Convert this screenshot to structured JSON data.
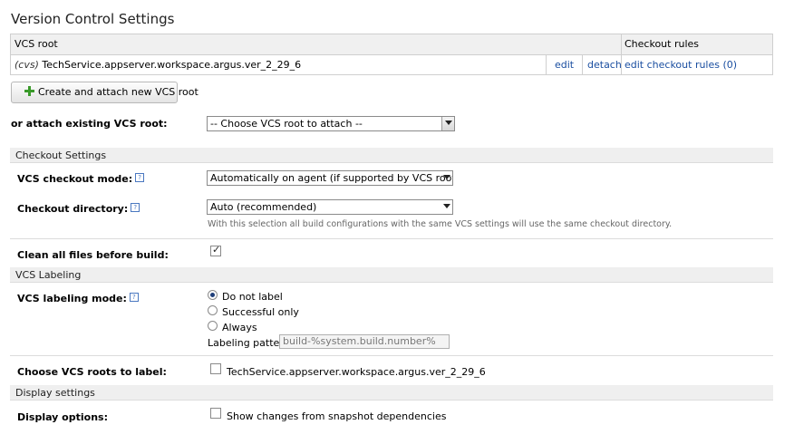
{
  "page": {
    "title": "Version Control Settings"
  },
  "vcs_table": {
    "headers": {
      "root": "VCS root",
      "checkout_rules": "Checkout rules"
    },
    "rows": [
      {
        "type": "(cvs)",
        "name": "TechService.appserver.workspace.argus.ver_2_29_6",
        "edit": "edit",
        "detach": "detach",
        "rules": "edit checkout rules (0)"
      }
    ]
  },
  "create_button": {
    "label": "Create and attach new VCS root"
  },
  "attach_existing": {
    "label": "or attach existing VCS root:",
    "value": "-- Choose VCS root to attach --"
  },
  "checkout_settings": {
    "section": "Checkout Settings",
    "mode_label": "VCS checkout mode:",
    "mode_value": "Automatically on agent (if supported by VCS roots)",
    "dir_label": "Checkout directory:",
    "dir_value": "Auto (recommended)",
    "dir_note": "With this selection all build configurations with the same VCS settings will use the same checkout directory.",
    "clean_label": "Clean all files before build:",
    "clean_checked": true
  },
  "labeling": {
    "section": "VCS Labeling",
    "mode_label": "VCS labeling mode:",
    "options": [
      "Do not label",
      "Successful only",
      "Always"
    ],
    "selected": 0,
    "pattern_label": "Labeling pattern:",
    "pattern_value": "build-%system.build.number%",
    "roots_label": "Choose VCS roots to label:",
    "root_option": "TechService.appserver.workspace.argus.ver_2_29_6"
  },
  "display": {
    "section": "Display settings",
    "label": "Display options:",
    "option": "Show changes from snapshot dependencies"
  },
  "icons": {
    "help": "help-icon",
    "add": "plus-icon",
    "dropdown": "dropdown-arrow-icon"
  },
  "colors": {
    "link": "#1a4ea0",
    "add_icon": "#3a9a2a",
    "section_bg": "#efefef"
  }
}
